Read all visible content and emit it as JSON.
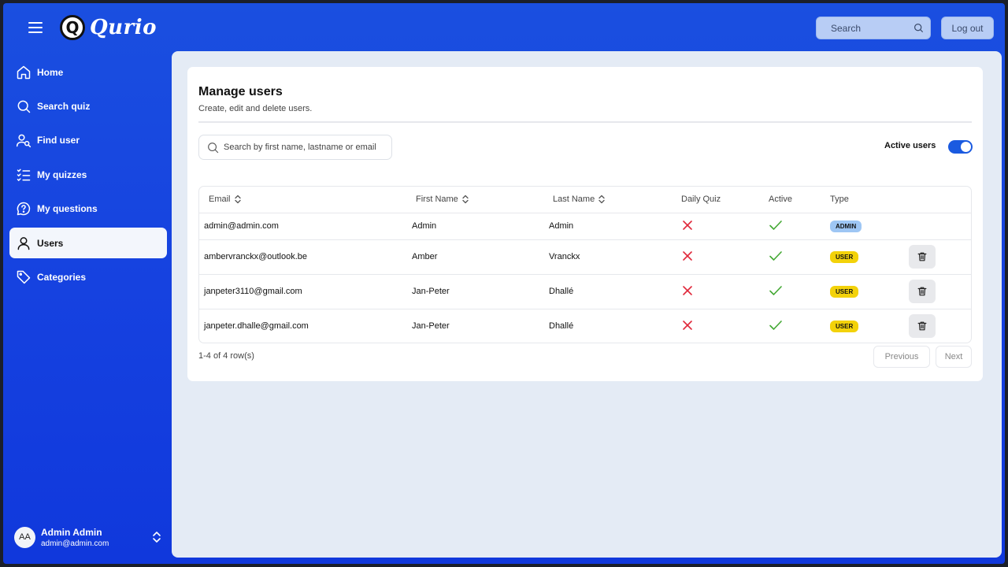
{
  "app": {
    "name": "Qurio",
    "logo_glyph": "Q"
  },
  "header": {
    "search_label": "Search",
    "logout_label": "Log out"
  },
  "sidebar": {
    "items": [
      {
        "label": "Home",
        "icon": "home-icon"
      },
      {
        "label": "Search quiz",
        "icon": "search-icon"
      },
      {
        "label": "Find user",
        "icon": "user-search-icon"
      },
      {
        "label": "My quizzes",
        "icon": "list-check-icon"
      },
      {
        "label": "My questions",
        "icon": "question-bubble-icon"
      },
      {
        "label": "Users",
        "icon": "user-icon",
        "active": true
      },
      {
        "label": "Categories",
        "icon": "tag-icon"
      }
    ],
    "user": {
      "initials": "AA",
      "name": "Admin Admin",
      "email": "admin@admin.com"
    }
  },
  "page": {
    "title": "Manage users",
    "subtitle": "Create, edit and delete users.",
    "search_placeholder": "Search by first name, lastname or email",
    "active_users_label": "Active users",
    "active_users_on": true
  },
  "table": {
    "headers": {
      "email": "Email",
      "first_name": "First Name",
      "last_name": "Last Name",
      "daily_quiz": "Daily Quiz",
      "active": "Active",
      "type": "Type"
    },
    "rows": [
      {
        "email": "admin@admin.com",
        "first": "Admin",
        "last": "Admin",
        "daily": false,
        "active": true,
        "type": "ADMIN",
        "deletable": false
      },
      {
        "email": "ambervranckx@outlook.be",
        "first": "Amber",
        "last": "Vranckx",
        "daily": false,
        "active": true,
        "type": "USER",
        "deletable": true
      },
      {
        "email": "janpeter3110@gmail.com",
        "first": "Jan-Peter",
        "last": "Dhallé",
        "daily": false,
        "active": true,
        "type": "USER",
        "deletable": true
      },
      {
        "email": "janpeter.dhalle@gmail.com",
        "first": "Jan-Peter",
        "last": "Dhallé",
        "daily": false,
        "active": true,
        "type": "USER",
        "deletable": true
      }
    ]
  },
  "pagination": {
    "summary": "1-4 of 4 row(s)",
    "previous": "Previous",
    "next": "Next"
  },
  "colors": {
    "brand": "#1642e0",
    "toggle_on": "#1a5ae0",
    "cross": "#e0283a",
    "check": "#43a833",
    "admin_badge": "#9ec6f4",
    "user_badge": "#f3d20a"
  }
}
